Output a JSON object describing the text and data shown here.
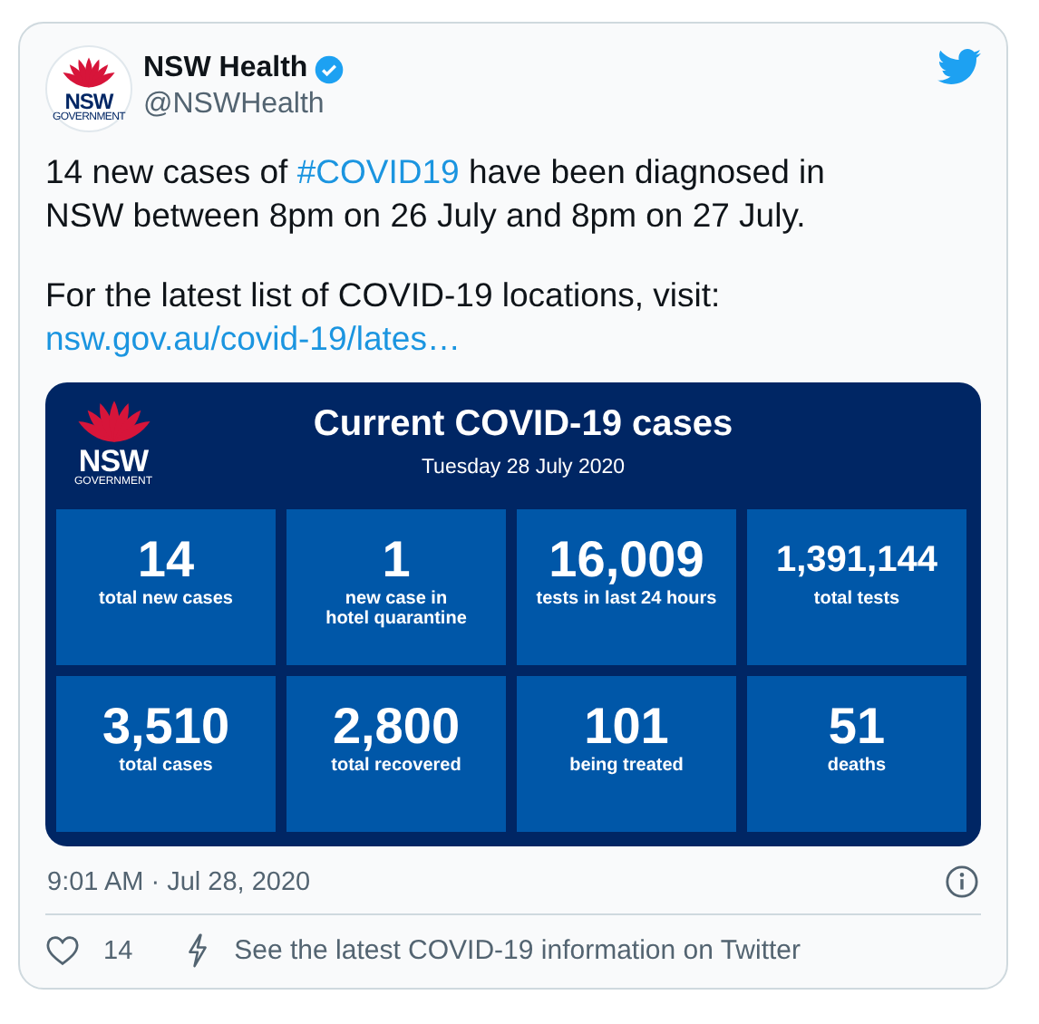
{
  "author": {
    "name": "NSW Health",
    "handle": "@NSWHealth",
    "verified": true,
    "logo": {
      "word": "NSW",
      "sub": "GOVERNMENT"
    }
  },
  "tweet": {
    "paragraphs": [
      {
        "before": "14 new cases of ",
        "link": "#COVID19",
        "after": " have been diagnosed in NSW between 8pm on 26 July and 8pm on 27 July."
      },
      {
        "before": "For the latest list of COVID-19 locations, visit: ",
        "link": "nsw.gov.au/covid-19/lates…"
      }
    ]
  },
  "infographic": {
    "logo": {
      "word": "NSW",
      "sub": "GOVERNMENT"
    },
    "title": "Current COVID-19 cases",
    "date": "Tuesday 28 July 2020",
    "stats": [
      {
        "value": "14",
        "label": "total new cases"
      },
      {
        "value": "1",
        "label": "new case in\nhotel quarantine"
      },
      {
        "value": "16,009",
        "label": "tests in last 24 hours"
      },
      {
        "value": "1,391,144",
        "label": "total tests"
      },
      {
        "value": "3,510",
        "label": "total cases"
      },
      {
        "value": "2,800",
        "label": "total recovered"
      },
      {
        "value": "101",
        "label": "being treated"
      },
      {
        "value": "51",
        "label": "deaths"
      }
    ]
  },
  "timestamp": "9:01 AM · Jul 28, 2020",
  "likes": "14",
  "covid_link": "See the latest COVID-19 information on Twitter"
}
